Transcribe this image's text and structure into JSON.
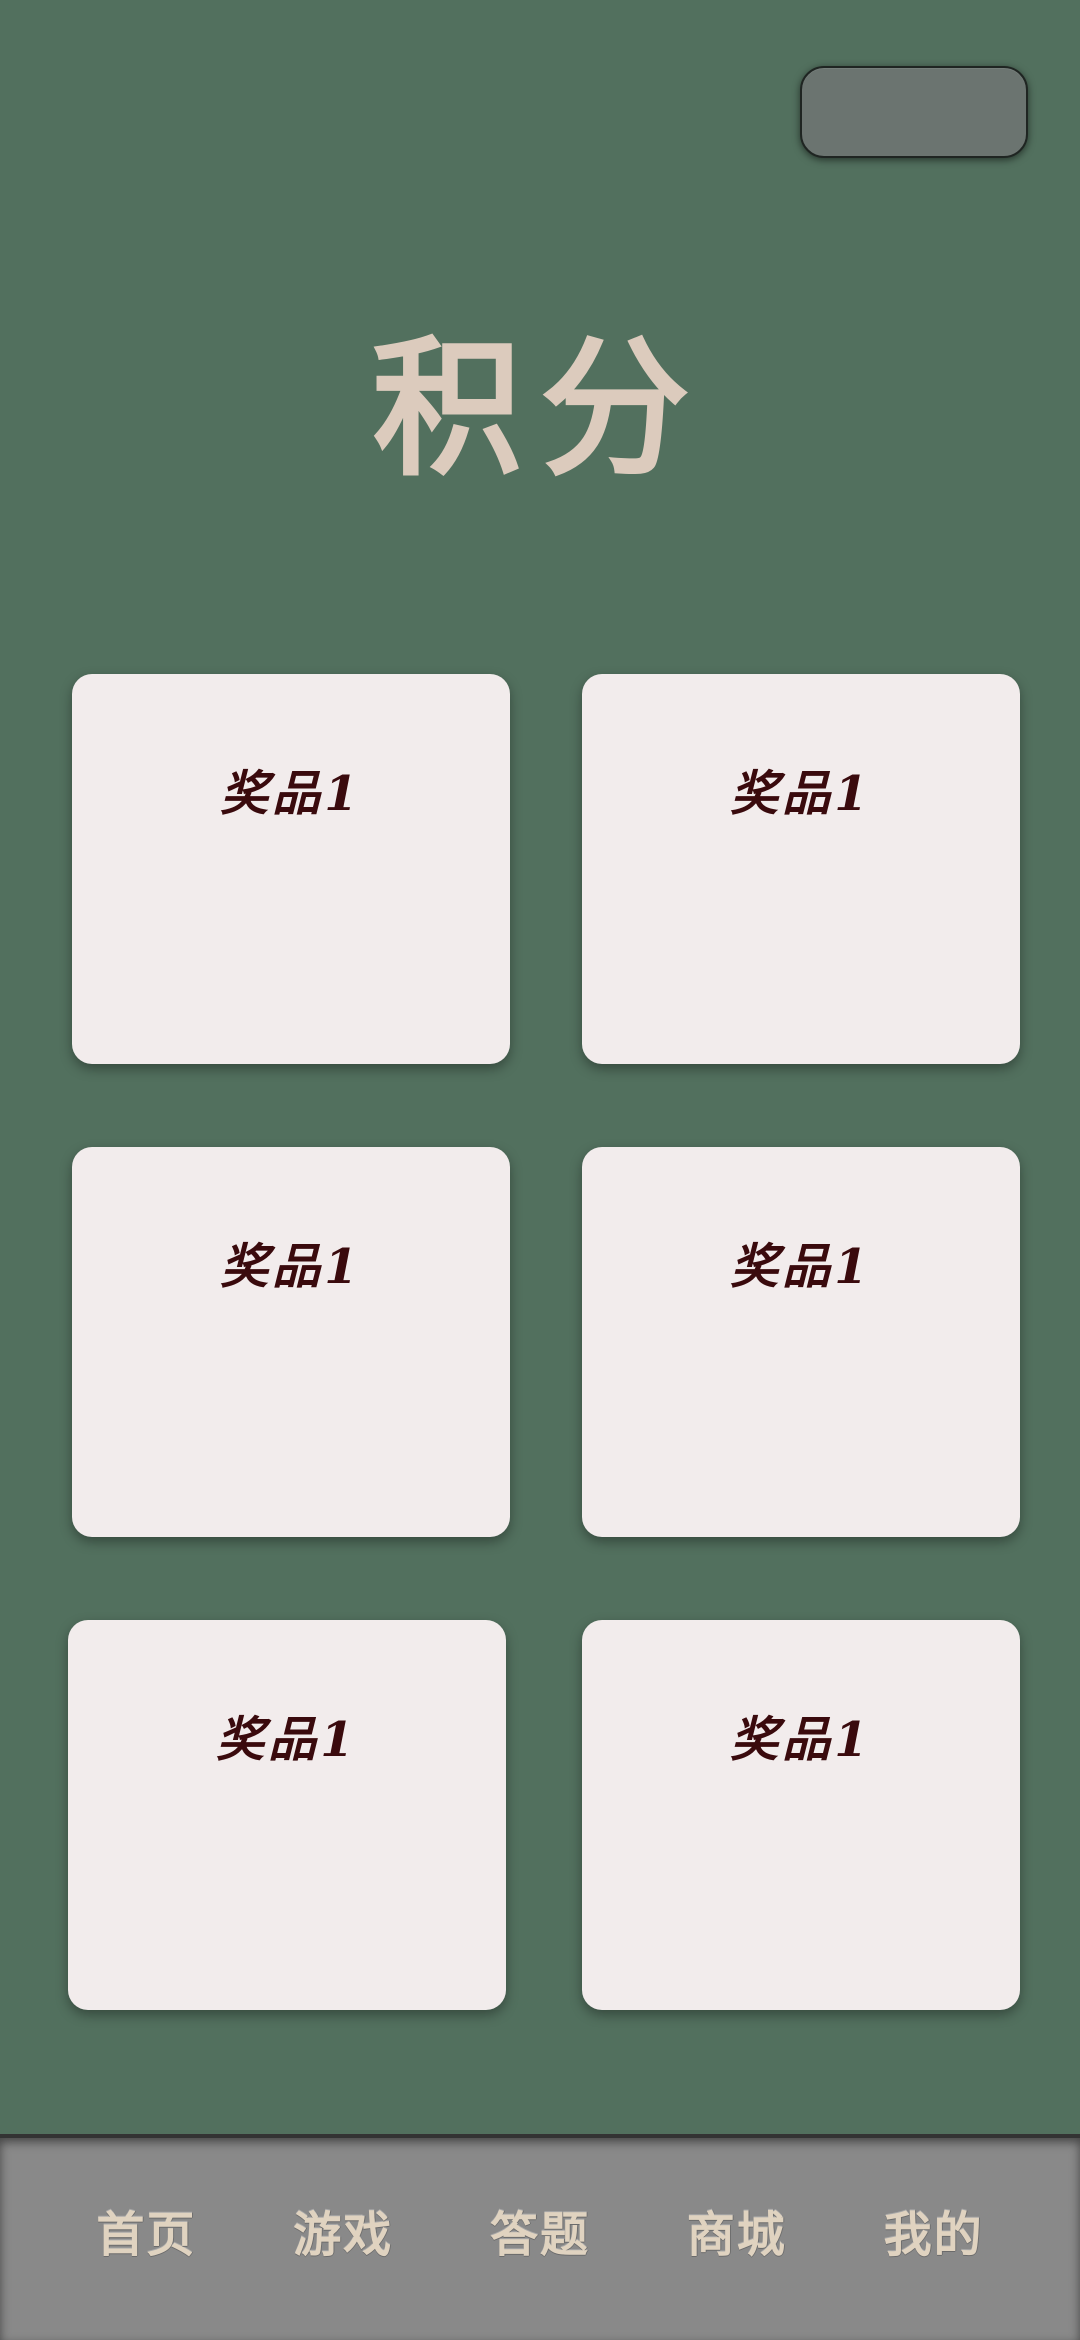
{
  "header": {
    "title": "积分"
  },
  "prizes": [
    {
      "label": "奖品1"
    },
    {
      "label": "奖品1"
    },
    {
      "label": "奖品1"
    },
    {
      "label": "奖品1"
    },
    {
      "label": "奖品1"
    },
    {
      "label": "奖品1"
    }
  ],
  "bottom_nav": {
    "items": [
      {
        "label": "首页"
      },
      {
        "label": "游戏"
      },
      {
        "label": "答题"
      },
      {
        "label": "商城"
      },
      {
        "label": "我的"
      }
    ]
  },
  "colors": {
    "background": "#52705e",
    "title": "#dccbbd",
    "card": "#f2ecec",
    "card_text": "#3a0a0d",
    "nav_bar": "#898989",
    "nav_text": "#e0d3c0",
    "top_button": "#6b7470"
  }
}
